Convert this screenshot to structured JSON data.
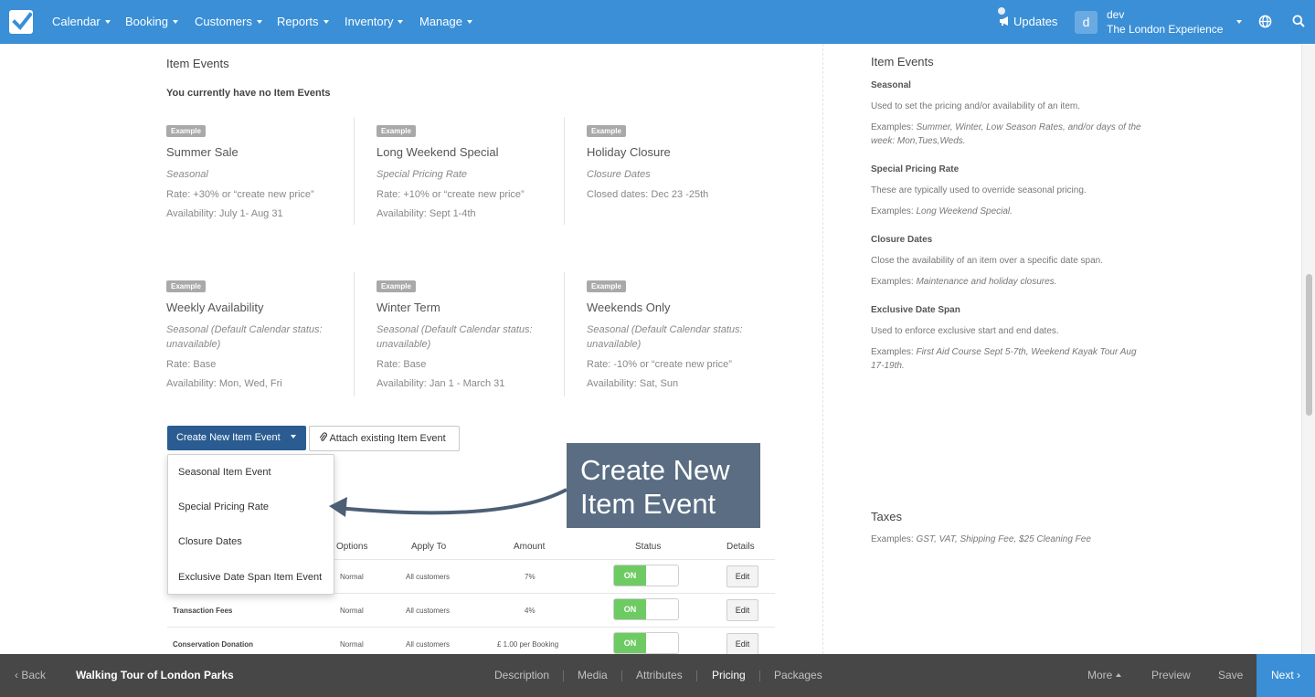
{
  "nav": {
    "items": [
      {
        "label": "Calendar"
      },
      {
        "label": "Booking"
      },
      {
        "label": "Customers"
      },
      {
        "label": "Reports"
      },
      {
        "label": "Inventory"
      },
      {
        "label": "Manage"
      }
    ],
    "updates_label": "Updates",
    "avatar_letter": "d",
    "user_name": "dev",
    "user_org": "The London Experience"
  },
  "events": {
    "title": "Item Events",
    "no_events": "You currently have no Item Events",
    "badge": "Example",
    "cards": [
      {
        "title": "Summer Sale",
        "type": "Seasonal",
        "lines": [
          "Rate: +30% or “create new price”",
          "Availability: July 1- Aug 31"
        ]
      },
      {
        "title": "Long Weekend Special",
        "type": "Special Pricing Rate",
        "lines": [
          "Rate: +10% or “create new price”",
          "Availability: Sept 1-4th"
        ]
      },
      {
        "title": "Holiday Closure",
        "type": "Closure Dates",
        "lines": [
          "Closed dates: Dec 23 -25th"
        ]
      },
      {
        "title": "Weekly Availability",
        "type": "Seasonal (Default Calendar status: unavailable)",
        "lines": [
          "Rate: Base",
          "Availability: Mon, Wed, Fri"
        ]
      },
      {
        "title": "Winter Term",
        "type": "Seasonal (Default Calendar status: unavailable)",
        "lines": [
          "Rate: Base",
          "Availability: Jan 1 - March 31"
        ]
      },
      {
        "title": "Weekends Only",
        "type": "Seasonal (Default Calendar status: unavailable)",
        "lines": [
          "Rate: -10% or “create new price”",
          "Availability: Sat, Sun"
        ]
      }
    ],
    "create_button": "Create New Item Event",
    "attach_button": "Attach existing Item Event",
    "dropdown": [
      "Seasonal Item Event",
      "Special Pricing Rate",
      "Closure Dates",
      "Exclusive Date Span Item Event"
    ]
  },
  "callout": {
    "line1": "Create New",
    "line2": "Item Event"
  },
  "taxes_table": {
    "headers": [
      "Options",
      "Apply To",
      "Amount",
      "Status",
      "Details"
    ],
    "rows": [
      {
        "name": "",
        "option": "Normal",
        "apply": "All customers",
        "amount": "7%",
        "status": "ON",
        "action": "Edit"
      },
      {
        "name": "Transaction Fees",
        "option": "Normal",
        "apply": "All customers",
        "amount": "4%",
        "status": "ON",
        "action": "Edit"
      },
      {
        "name": "Conservation Donation",
        "option": "Normal",
        "apply": "All customers",
        "amount": "£ 1.00 per Booking",
        "status": "ON",
        "action": "Edit"
      }
    ]
  },
  "right_panel": {
    "title": "Item Events",
    "sections": [
      {
        "head": "Seasonal",
        "desc": "Used to set the pricing and/or availability of an item.",
        "ex_prefix": "Examples: ",
        "ex": "Summer, Winter, Low Season Rates, and/or days of the week: Mon,Tues,Weds."
      },
      {
        "head": "Special Pricing Rate",
        "desc": "These are typically used to override seasonal pricing.",
        "ex_prefix": "Examples: ",
        "ex": "Long Weekend Special."
      },
      {
        "head": "Closure Dates",
        "desc": "Close the availability of an item over a specific date span.",
        "ex_prefix": "Examples: ",
        "ex": "Maintenance and holiday closures."
      },
      {
        "head": "Exclusive Date Span",
        "desc": "Used to enforce exclusive start and end dates.",
        "ex_prefix": "Examples: ",
        "ex": "First Aid Course Sept 5-7th, Weekend Kayak Tour Aug 17-19th."
      }
    ],
    "taxes_title": "Taxes",
    "taxes_ex_prefix": "Examples: ",
    "taxes_ex": "GST, VAT, Shipping Fee, $25 Cleaning Fee"
  },
  "bottom": {
    "back": "Back",
    "title": "Walking Tour of London Parks",
    "tabs": [
      "Description",
      "Media",
      "Attributes",
      "Pricing",
      "Packages"
    ],
    "active_tab": "Pricing",
    "more": "More",
    "preview": "Preview",
    "save": "Save",
    "next": "Next"
  },
  "colors": {
    "brand": "#3a8fd6",
    "dark_button": "#2a5c91",
    "toggle_on": "#6ecb63",
    "callout": "#5a6d83"
  }
}
